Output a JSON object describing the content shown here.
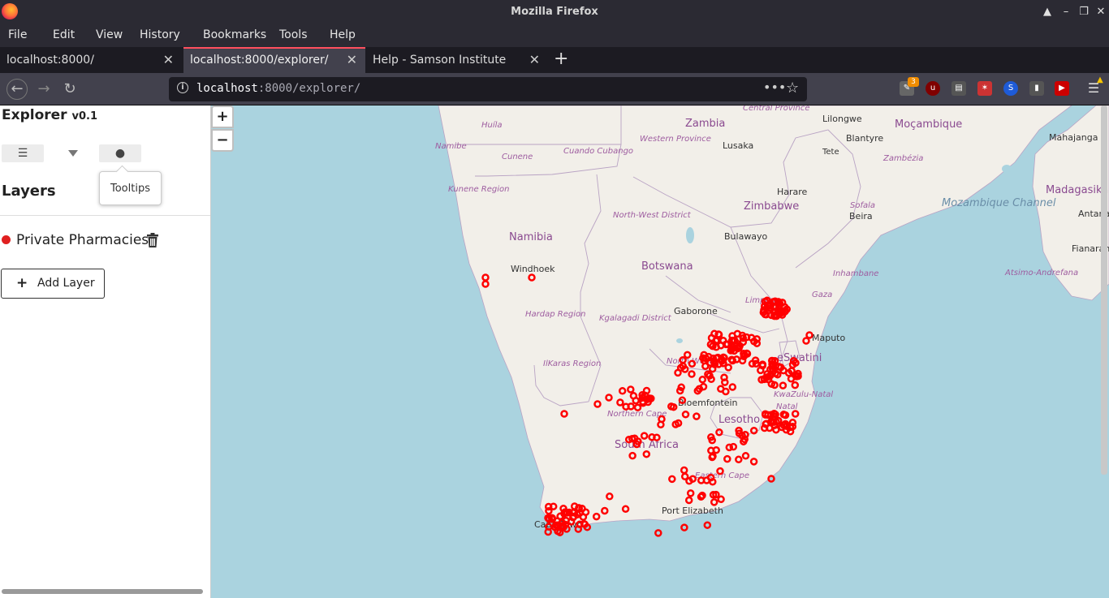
{
  "window": {
    "title": "Mozilla Firefox"
  },
  "menu": [
    "File",
    "Edit",
    "View",
    "History",
    "Bookmarks",
    "Tools",
    "Help"
  ],
  "tabs": [
    {
      "label": "localhost:8000/",
      "active": false
    },
    {
      "label": "localhost:8000/explorer/",
      "active": true
    },
    {
      "label": "Help - Samson Institute",
      "active": false
    }
  ],
  "url": {
    "host": "localhost",
    "rest": ":8000/explorer/"
  },
  "extensions": {
    "badge_count": "3"
  },
  "sidebar": {
    "app_title": "Explorer",
    "version": "v0.1",
    "tabs": [
      {
        "icon": "hamburger-icon"
      },
      {
        "icon": "filter-icon"
      },
      {
        "icon": "tooltip-icon"
      }
    ],
    "tooltip": "Tooltips",
    "layers_heading": "Layers",
    "layer": {
      "name": "Private Pharmacies",
      "color": "#e02020"
    },
    "add_layer": "Add Layer"
  },
  "map": {
    "zoom_in": "+",
    "zoom_out": "−",
    "marker_color": "#ff0000",
    "labels": {
      "countries": [
        "Zambia",
        "Namibia",
        "Botswana",
        "Zimbabwe",
        "South Africa",
        "Lesotho",
        "eSwatini",
        "Moçambique",
        "Madagasikara"
      ],
      "cities": [
        "Lilongwe",
        "Lusaka",
        "Blantyre",
        "Harare",
        "Beira",
        "Bulawayo",
        "Windhoek",
        "Gaborone",
        "Maputo",
        "Mahajanga",
        "Antananarivo",
        "Fianarantsoa",
        "Port Elizabeth",
        "Cape Town",
        "Bloemfontein",
        "Tete"
      ],
      "regions": [
        "Central Province",
        "Western Province",
        "Huíla",
        "Namibe",
        "Cuando Cubango",
        "Cunene",
        "Kunene Region",
        "Zambézia",
        "Sofala",
        "Inhambane",
        "Gaza",
        "Limpopo",
        "North-West District",
        "Kgalagadi District",
        "Hardap Region",
        "IlKaras Region",
        "North West",
        "Northern Cape",
        "Eastern Cape",
        "KwaZulu-Natal",
        "Atsimo-Andrefana",
        "Natal"
      ],
      "water": [
        "Mozambique Channel"
      ]
    }
  }
}
